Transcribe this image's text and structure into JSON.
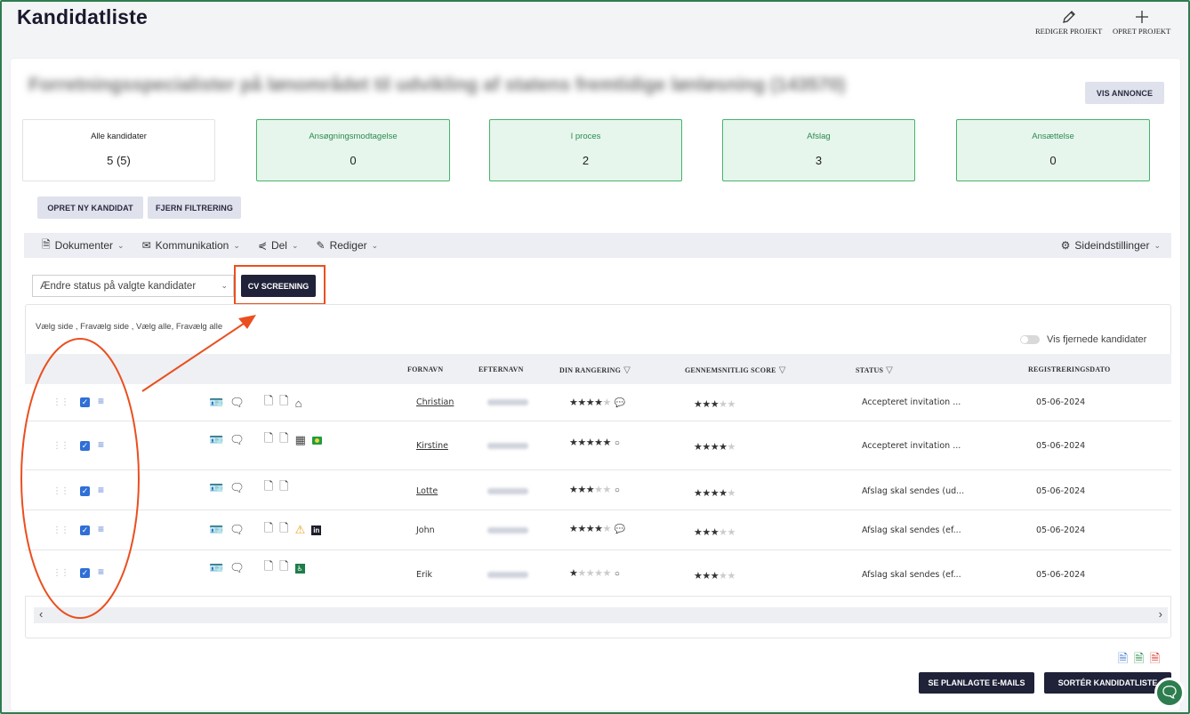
{
  "header": {
    "title": "Kandidatliste",
    "edit_label": "REDIGER PROJEKT",
    "create_label": "OPRET PROJEKT"
  },
  "project": {
    "title": "Forretningsspecialister på lønområdet til udvikling af statens fremtidige lønløsning (143570)",
    "view_ad": "VIS ANNONCE"
  },
  "stats": [
    {
      "label": "Alle kandidater",
      "value": "5 (5)"
    },
    {
      "label": "Ansøgningsmodtagelse",
      "value": "0"
    },
    {
      "label": "I proces",
      "value": "2"
    },
    {
      "label": "Afslag",
      "value": "3"
    },
    {
      "label": "Ansættelse",
      "value": "0"
    }
  ],
  "actions": {
    "new_candidate": "OPRET NY KANDIDAT",
    "clear_filter": "FJERN FILTRERING"
  },
  "toolbar": {
    "documents": "Dokumenter",
    "communication": "Kommunikation",
    "share": "Del",
    "edit": "Rediger",
    "page_settings": "Sideindstillinger"
  },
  "status_select": {
    "value": "Ændre status på valgte kandidater",
    "cv_button": "CV SCREENING"
  },
  "selection": {
    "links": "Vælg side , Fravælg side , Vælg alle, Fravælg alle",
    "show_removed": "Vis fjernede kandidater"
  },
  "table": {
    "columns": {
      "first_name": "FORNAVN",
      "last_name": "EFTERNAVN",
      "rank": "DIN RANGERING",
      "avg_score": "GENNEMSNITLIG SCORE",
      "status": "STATUS",
      "reg_date": "REGISTRERINGSDATO"
    },
    "rows": [
      {
        "first_name": "Christian",
        "status": "Accepteret invitation ...",
        "date": "05-06-2024"
      },
      {
        "first_name": "Kirstine",
        "status": "Accepteret invitation ...",
        "date": "05-06-2024"
      },
      {
        "first_name": "Lotte",
        "status": "Afslag skal sendes (ud...",
        "date": "05-06-2024"
      },
      {
        "first_name": "John",
        "status": "Afslag skal sendes (ef...",
        "date": "05-06-2024"
      },
      {
        "first_name": "Erik",
        "status": "Afslag skal sendes (ef...",
        "date": "05-06-2024"
      }
    ]
  },
  "footer": {
    "scheduled_emails": "SE PLANLAGTE E-MAILS",
    "sort_list": "SORTÉR KANDIDATLISTE"
  },
  "colors": {
    "brand_green": "#2e7d4f",
    "dark_button": "#1f2238",
    "annotation": "#ea4f1f",
    "checkbox": "#2f6fd6"
  }
}
